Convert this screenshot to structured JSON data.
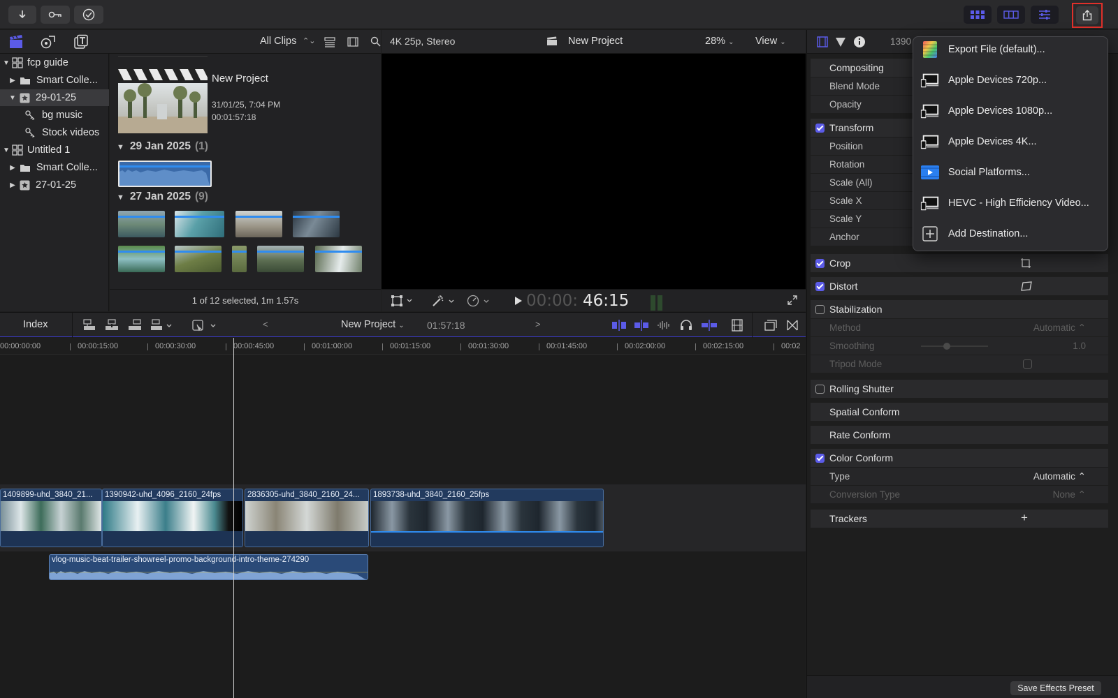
{
  "toolbar": {
    "import_icon": "download-arrow-icon",
    "keywords_icon": "key-icon",
    "background_tasks_icon": "checkmark-circle-icon",
    "right_buttons": [
      "browser-grid-icon",
      "timeline-icon",
      "inspector-sliders-icon"
    ],
    "share_icon": "share-icon"
  },
  "library_header": {
    "filter_label": "All Clips"
  },
  "sidebar": {
    "items": [
      {
        "label": "fcp guide",
        "level": 0,
        "expanded": true,
        "kind": "library"
      },
      {
        "label": "Smart Colle...",
        "level": 1,
        "expanded": false,
        "kind": "folder"
      },
      {
        "label": "29-01-25",
        "level": 1,
        "expanded": true,
        "kind": "event",
        "selected": true
      },
      {
        "label": "bg music",
        "level": 2,
        "kind": "keyword"
      },
      {
        "label": "Stock videos",
        "level": 2,
        "kind": "keyword"
      },
      {
        "label": "Untitled 1",
        "level": 0,
        "expanded": true,
        "kind": "library"
      },
      {
        "label": "Smart Colle...",
        "level": 1,
        "expanded": false,
        "kind": "folder"
      },
      {
        "label": "27-01-25",
        "level": 1,
        "expanded": false,
        "kind": "event"
      }
    ]
  },
  "browser": {
    "project": {
      "title": "New Project",
      "date": "31/01/25, 7:04 PM",
      "duration": "00:01:57:18"
    },
    "groups": [
      {
        "date": "29 Jan 2025",
        "count": "(1)"
      },
      {
        "date": "27 Jan 2025",
        "count": "(9)"
      }
    ],
    "footer": "1 of 12 selected, 1m 1.57s"
  },
  "viewer": {
    "format": "4K 25p, Stereo",
    "project_name": "New Project",
    "zoom": "28%",
    "view_label": "View",
    "timecode_dim": "00:00:",
    "timecode_bright": "46:15"
  },
  "timeline": {
    "index_label": "Index",
    "project_name": "New Project",
    "duration": "01:57:18",
    "ruler": [
      "00:00:00:00",
      "00:00:15:00",
      "00:00:30:00",
      "00:00:45:00",
      "00:01:00:00",
      "00:01:15:00",
      "00:01:30:00",
      "00:01:45:00",
      "00:02:00:00",
      "00:02:15:00",
      "00:02"
    ],
    "clips": [
      "1409899-uhd_3840_21...",
      "1390942-uhd_4096_2160_24fps",
      "2836305-uhd_3840_2160_24...",
      "1893738-uhd_3840_2160_25fps"
    ],
    "audio_clip": "vlog-music-beat-trailer-showreel-promo-background-intro-theme-274290"
  },
  "inspector": {
    "header_value": "1390",
    "sections": [
      {
        "title": "Compositing",
        "checkbox": null,
        "rows": [
          {
            "label": "Blend Mode"
          },
          {
            "label": "Opacity"
          }
        ]
      },
      {
        "title": "Transform",
        "checkbox": true,
        "rows": [
          {
            "label": "Position"
          },
          {
            "label": "Rotation"
          },
          {
            "label": "Scale (All)"
          },
          {
            "label": "Scale X"
          },
          {
            "label": "Scale Y"
          },
          {
            "label": "Anchor"
          }
        ]
      },
      {
        "title": "Crop",
        "checkbox": true
      },
      {
        "title": "Distort",
        "checkbox": true
      },
      {
        "title": "Stabilization",
        "checkbox": false,
        "rows": [
          {
            "label": "Method",
            "value": "Automatic ⌃",
            "dim": true
          },
          {
            "label": "Smoothing",
            "value": "1.0",
            "dim": true
          },
          {
            "label": "Tripod Mode",
            "dim": true
          }
        ]
      },
      {
        "title": "Rolling Shutter",
        "checkbox": false
      },
      {
        "title": "Spatial Conform",
        "checkbox": null
      },
      {
        "title": "Rate Conform",
        "checkbox": null
      },
      {
        "title": "Color Conform",
        "checkbox": true,
        "rows": [
          {
            "label": "Type",
            "value": "Automatic ⌃"
          },
          {
            "label": "Conversion Type",
            "value": "None ⌃",
            "dim": true
          }
        ]
      },
      {
        "title": "Trackers",
        "checkbox": null,
        "action": "+"
      }
    ],
    "save_preset": "Save Effects Preset"
  },
  "share_menu": {
    "items": [
      {
        "label": "Export File (default)...",
        "icon": "export-file-icon"
      },
      {
        "label": "Apple Devices 720p...",
        "icon": "apple-devices-icon"
      },
      {
        "label": "Apple Devices 1080p...",
        "icon": "apple-devices-icon"
      },
      {
        "label": "Apple Devices 4K...",
        "icon": "apple-devices-icon"
      },
      {
        "label": "Social Platforms...",
        "icon": "social-platforms-icon"
      },
      {
        "label": "HEVC - High Efficiency Video...",
        "icon": "apple-devices-icon"
      },
      {
        "label": "Add Destination...",
        "icon": "add-destination-icon"
      }
    ]
  },
  "colors": {
    "accent": "#5b5be8",
    "clip_blue": "#223a5e",
    "highlight_red": "#e0302a"
  }
}
